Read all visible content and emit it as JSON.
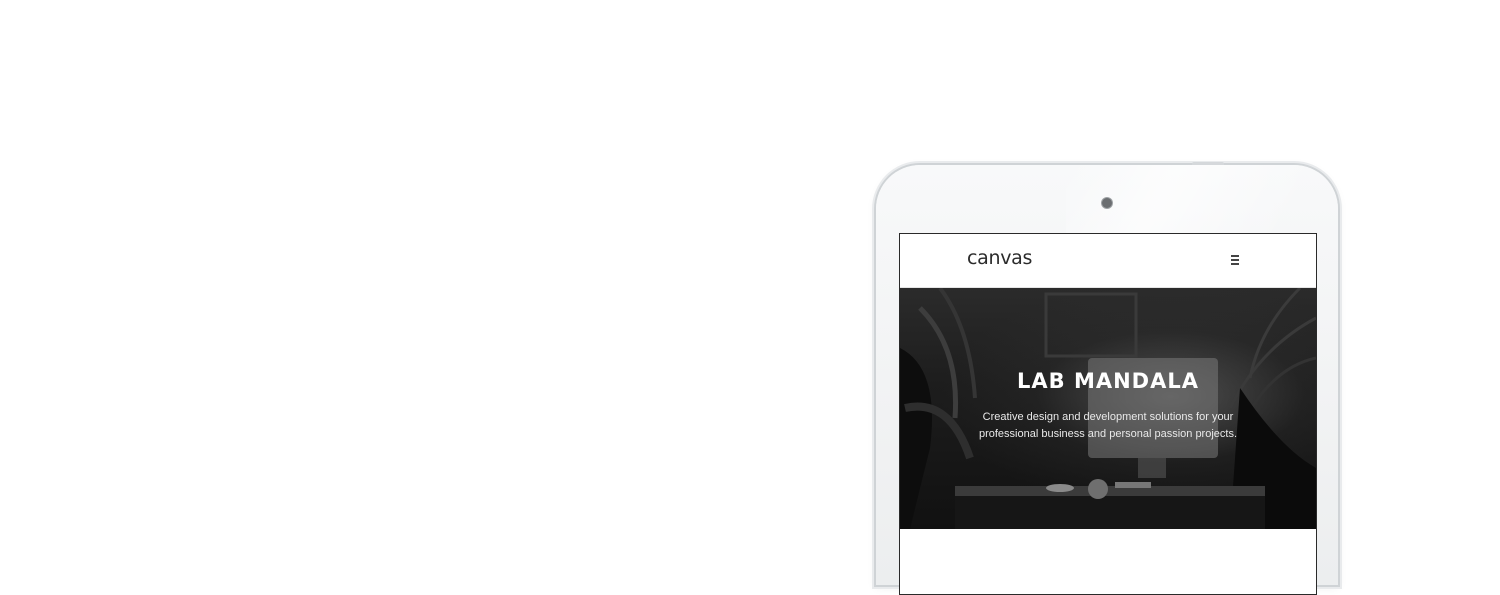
{
  "site": {
    "logo": "canvas",
    "menu_icon": "hamburger-icon"
  },
  "hero": {
    "title": "LAB MANDALA",
    "subtitle_lines": [
      "Creative design and development solutions for your",
      "professional business and personal passion projects."
    ]
  },
  "colors": {
    "background": "#ffffff",
    "device_frame": "#f1f2f3",
    "hero_dark": "#1d1d1d",
    "hero_text": "#ffffff"
  }
}
